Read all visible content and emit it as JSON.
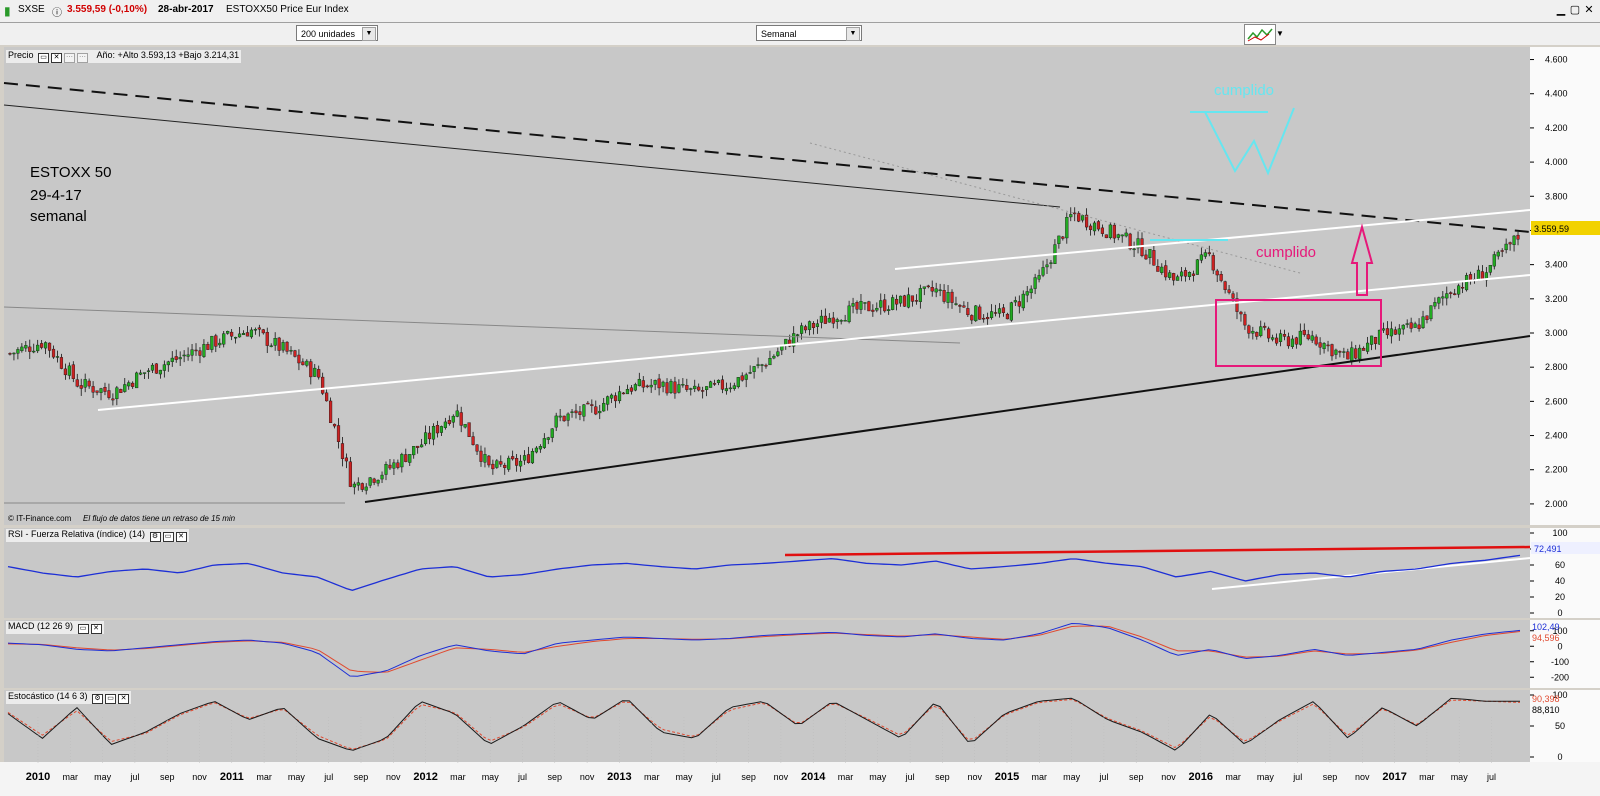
{
  "window": {
    "symbol": "SXSE",
    "price_change": "3.559,59 (-0,10%)",
    "date": "28-abr-2017",
    "instrument": "ESTOXX50 Price Eur Index"
  },
  "toolbar": {
    "units": "200 unidades",
    "period": "Semanal"
  },
  "price_panel": {
    "label": "Precio",
    "year_info": "Año: +Alto 3.593,13 +Bajo 3.214,31",
    "annotation_title": "ESTOXX 50",
    "annotation_date": "29-4-17",
    "annotation_period": "semanal",
    "cumplido_top": "cumplido",
    "cumplido_mid": "cumplido",
    "last_price": "3.559,59",
    "copyright": "© IT-Finance.com",
    "delay_note": "El flujo de datos tiene un retraso de 15 min",
    "colors": {
      "background": "#c8c8c8",
      "bull": "#22aa22",
      "bear": "#cc2222",
      "cyan": "#66e6f0",
      "magenta": "#e6197a"
    }
  },
  "rsi_panel": {
    "label": "RSI - Fuerza Relativa (índice) (14)",
    "value": "72,491"
  },
  "macd_panel": {
    "label": "MACD (12 26 9)",
    "value_macd": "102,49",
    "value_signal": "94,596"
  },
  "stoch_panel": {
    "label": "Estocástico (14 6 3)",
    "value_k": "90,398",
    "value_d": "88,810"
  },
  "chart_data": [
    {
      "type": "candlestick",
      "title": "ESTOXX50 Price Eur Index",
      "x": [
        "2010-01",
        "2010-03",
        "2010-05",
        "2010-07",
        "2010-09",
        "2010-11",
        "2011-01",
        "2011-03",
        "2011-05",
        "2011-07",
        "2011-09",
        "2011-11",
        "2012-01",
        "2012-03",
        "2012-05",
        "2012-07",
        "2012-09",
        "2012-11",
        "2013-01",
        "2013-03",
        "2013-05",
        "2013-07",
        "2013-09",
        "2013-11",
        "2014-01",
        "2014-03",
        "2014-05",
        "2014-07",
        "2014-09",
        "2014-11",
        "2015-01",
        "2015-03",
        "2015-05",
        "2015-07",
        "2015-09",
        "2015-11",
        "2016-01",
        "2016-03",
        "2016-05",
        "2016-07",
        "2016-09",
        "2016-11",
        "2017-01",
        "2017-03",
        "2017-04"
      ],
      "y": [
        2880,
        2950,
        2700,
        2650,
        2780,
        2860,
        2950,
        3020,
        2900,
        2750,
        2100,
        2200,
        2350,
        2550,
        2200,
        2250,
        2500,
        2550,
        2680,
        2700,
        2650,
        2700,
        2820,
        3000,
        3100,
        3150,
        3180,
        3250,
        3120,
        3100,
        3300,
        3700,
        3600,
        3500,
        3300,
        3450,
        3050,
        2950,
        2980,
        2850,
        2980,
        3030,
        3250,
        3350,
        3560
      ],
      "ylim": [
        1900,
        4650
      ],
      "y_ticks": [
        "4.600",
        "4.400",
        "4.200",
        "4.000",
        "3.800",
        "3.600",
        "3.400",
        "3.200",
        "3.000",
        "2.800",
        "2.600",
        "2.400",
        "2.200",
        "2.000"
      ],
      "x_tick_labels": [
        "2010",
        "mar",
        "may",
        "jul",
        "sep",
        "nov",
        "2011",
        "mar",
        "may",
        "jul",
        "sep",
        "nov",
        "2012",
        "mar",
        "may",
        "jul",
        "sep",
        "nov",
        "2013",
        "mar",
        "may",
        "jul",
        "sep",
        "nov",
        "2014",
        "mar",
        "may",
        "jul",
        "sep",
        "nov",
        "2015",
        "mar",
        "may",
        "jul",
        "sep",
        "nov",
        "2016",
        "mar",
        "may",
        "jul",
        "sep",
        "nov",
        "2017",
        "mar",
        "may",
        "jul"
      ]
    },
    {
      "type": "line",
      "title": "RSI - Fuerza Relativa (índice) (14)",
      "y": [
        58,
        50,
        45,
        52,
        55,
        50,
        60,
        62,
        50,
        45,
        28,
        42,
        55,
        58,
        45,
        48,
        55,
        60,
        62,
        58,
        55,
        60,
        62,
        65,
        68,
        62,
        60,
        65,
        55,
        58,
        62,
        68,
        62,
        58,
        45,
        52,
        40,
        48,
        50,
        45,
        52,
        55,
        62,
        66,
        72
      ],
      "ylim": [
        0,
        100
      ],
      "y_ticks": [
        "100",
        "80",
        "60",
        "40",
        "20",
        "0"
      ]
    },
    {
      "type": "line",
      "title": "MACD (12 26 9)",
      "series": [
        {
          "name": "MACD",
          "values": [
            20,
            10,
            -20,
            -30,
            -10,
            10,
            30,
            40,
            20,
            -40,
            -200,
            -160,
            -60,
            10,
            -30,
            -50,
            20,
            40,
            60,
            50,
            40,
            50,
            70,
            80,
            90,
            70,
            60,
            80,
            50,
            40,
            80,
            150,
            120,
            40,
            -60,
            -20,
            -80,
            -60,
            -20,
            -60,
            -40,
            -20,
            40,
            80,
            102
          ]
        },
        {
          "name": "Señal",
          "values": [
            15,
            12,
            -10,
            -25,
            -15,
            5,
            25,
            35,
            25,
            -20,
            -160,
            -170,
            -90,
            -10,
            -20,
            -40,
            0,
            30,
            50,
            50,
            45,
            48,
            62,
            75,
            85,
            75,
            65,
            75,
            60,
            45,
            70,
            130,
            130,
            60,
            -30,
            -30,
            -70,
            -65,
            -30,
            -50,
            -45,
            -25,
            25,
            70,
            95
          ]
        }
      ],
      "ylim": [
        -250,
        150
      ],
      "y_ticks": [
        "100",
        "0",
        "-100",
        "-200"
      ]
    },
    {
      "type": "line",
      "title": "Estocástico (14 6 3)",
      "series": [
        {
          "name": "%K",
          "values": [
            70,
            30,
            80,
            20,
            40,
            70,
            90,
            60,
            80,
            30,
            10,
            30,
            90,
            70,
            20,
            50,
            90,
            60,
            95,
            40,
            30,
            80,
            90,
            50,
            90,
            60,
            30,
            90,
            20,
            70,
            90,
            95,
            60,
            40,
            10,
            70,
            20,
            60,
            90,
            30,
            80,
            50,
            95,
            90,
            90
          ]
        },
        {
          "name": "%D",
          "values": [
            72,
            35,
            75,
            25,
            38,
            68,
            88,
            62,
            78,
            35,
            12,
            28,
            85,
            72,
            25,
            48,
            86,
            62,
            92,
            45,
            32,
            76,
            88,
            52,
            88,
            62,
            34,
            86,
            24,
            68,
            88,
            93,
            62,
            42,
            14,
            66,
            24,
            58,
            86,
            34,
            78,
            52,
            92,
            90,
            88
          ]
        }
      ],
      "ylim": [
        0,
        100
      ],
      "y_ticks": [
        "100",
        "50",
        "0"
      ]
    }
  ]
}
